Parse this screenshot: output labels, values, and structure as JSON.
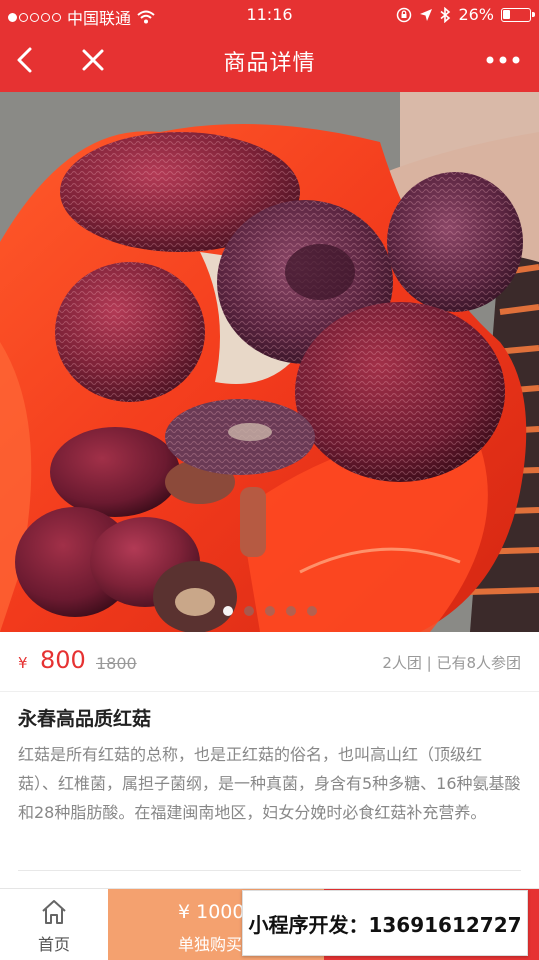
{
  "status_bar": {
    "carrier": "中国联通",
    "time": "11:16",
    "battery_percent_text": "26%",
    "battery_level": 0.26
  },
  "nav": {
    "title": "商品详情"
  },
  "carousel": {
    "page_count": 5,
    "active_index": 0
  },
  "price": {
    "currency": "¥",
    "current": "800",
    "original": "1800",
    "group_info": "2人团 | 已有8人参团"
  },
  "product": {
    "title": "永春高品质红菇",
    "description": "红菇是所有红菇的总称，也是正红菇的俗名，也叫高山红（顶级红菇）、红椎菌，属担子菌纲，是一种真菌，身含有5种多糖、16种氨基酸和28种脂肪酸。在福建闽南地区，妇女分娩时必食红菇补充营养。"
  },
  "bottom_bar": {
    "home_label": "首页",
    "solo_price": "¥ 1000",
    "solo_label": "单独购买"
  },
  "promo_overlay": {
    "text": "小程序开发：13691612727"
  },
  "colors": {
    "brand_red": "#e63232",
    "solo_orange": "#f4a16f",
    "muted_text": "#999999"
  }
}
